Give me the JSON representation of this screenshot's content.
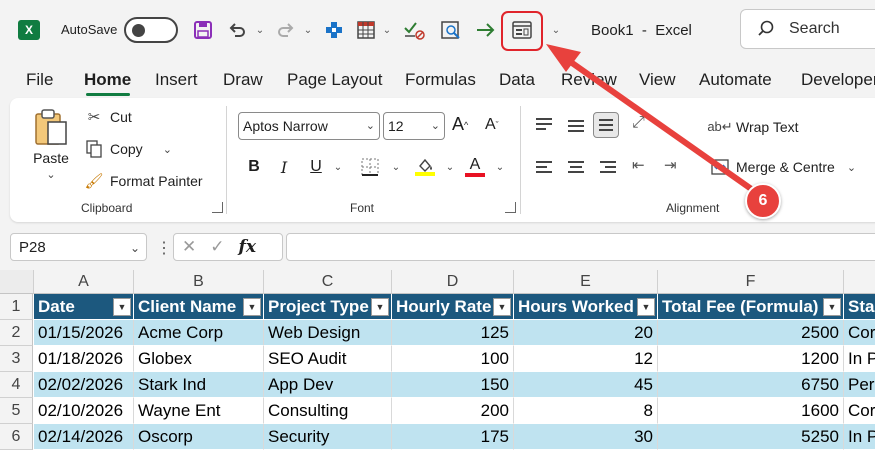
{
  "titlebar": {
    "autosave_label": "AutoSave",
    "book_title": "Book1  -  Excel",
    "search_label": "Search"
  },
  "menu": {
    "tabs": [
      "File",
      "Home",
      "Insert",
      "Draw",
      "Page Layout",
      "Formulas",
      "Data",
      "Review",
      "View",
      "Automate",
      "Developer"
    ],
    "active": "Home"
  },
  "ribbon": {
    "clipboard": {
      "paste": "Paste",
      "cut": "Cut",
      "copy": "Copy",
      "format_painter": "Format Painter",
      "group_label": "Clipboard"
    },
    "font": {
      "font_name": "Aptos Narrow",
      "font_size": "12",
      "bold": "B",
      "italic": "I",
      "underline": "U",
      "group_label": "Font",
      "highlight_color": "#ffff00",
      "font_color": "#e81123"
    },
    "alignment": {
      "wrap_text": "Wrap Text",
      "merge_centre": "Merge & Centre",
      "group_label": "Alignment"
    }
  },
  "formula_bar": {
    "name_box": "P28",
    "fx": "fx",
    "value": ""
  },
  "sheet": {
    "columns": [
      "A",
      "B",
      "C",
      "D",
      "E",
      "F"
    ],
    "rows": [
      "1",
      "2",
      "3",
      "4",
      "5",
      "6"
    ],
    "header": [
      "Date",
      "Client Name",
      "Project Type",
      "Hourly Rate",
      "Hours Worked",
      "Total Fee (Formula)",
      "Sta"
    ],
    "data": [
      [
        "01/15/2026",
        "Acme Corp",
        "Web Design",
        "125",
        "20",
        "2500",
        "Cor"
      ],
      [
        "01/18/2026",
        "Globex",
        "SEO Audit",
        "100",
        "12",
        "1200",
        "In P"
      ],
      [
        " 02/02/2026",
        "Stark Ind",
        "App Dev",
        "150",
        "45",
        "6750",
        "Per"
      ],
      [
        " 02/10/2026",
        "Wayne Ent",
        "Consulting",
        "200",
        "8",
        "1600",
        "Cor"
      ],
      [
        "02/14/2026",
        "Oscorp",
        "Security",
        "175",
        "30",
        "5250",
        "In P"
      ]
    ],
    "table_header_color": "#1c587e",
    "band_color": "#bfe3f0"
  },
  "annotation": {
    "step_number": "6",
    "color": "#e8413d"
  }
}
